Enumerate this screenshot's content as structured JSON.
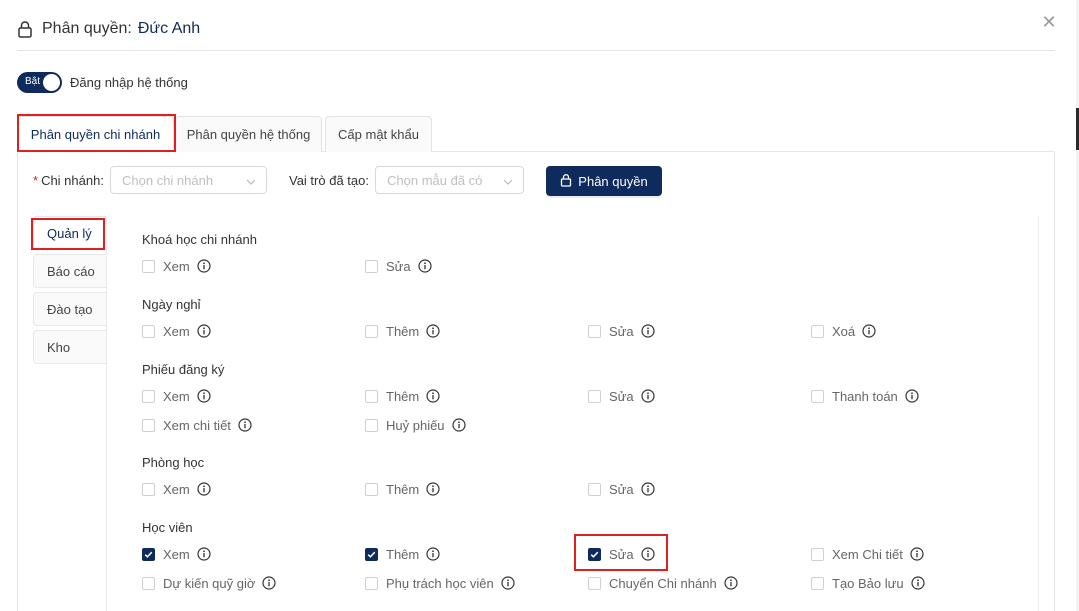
{
  "header": {
    "title_prefix": "Phân quyền:",
    "title_name": "Đức Anh"
  },
  "toggle": {
    "state_label": "Bật",
    "label": "Đăng nhập hệ thống"
  },
  "tabs": [
    {
      "label": "Phân quyền chi nhánh",
      "active": true
    },
    {
      "label": "Phân quyền hệ thống",
      "active": false
    },
    {
      "label": "Cấp mật khẩu",
      "active": false
    }
  ],
  "filters": {
    "branch_label": "Chi nhánh:",
    "branch_placeholder": "Chọn chi nhánh",
    "role_label": "Vai trò đã tạo:",
    "role_placeholder": "Chọn mẫu đã có",
    "submit_label": "Phân quyền"
  },
  "side_tabs": [
    {
      "label": "Quản lý",
      "active": true
    },
    {
      "label": "Báo cáo",
      "active": false
    },
    {
      "label": "Đào tạo",
      "active": false
    },
    {
      "label": "Kho",
      "active": false
    }
  ],
  "sections": [
    {
      "title": "Khoá học chi nhánh",
      "items": [
        {
          "label": "Xem",
          "checked": false
        },
        {
          "label": "Sửa",
          "checked": false
        }
      ]
    },
    {
      "title": "Ngày nghỉ",
      "items": [
        {
          "label": "Xem",
          "checked": false
        },
        {
          "label": "Thêm",
          "checked": false
        },
        {
          "label": "Sửa",
          "checked": false
        },
        {
          "label": "Xoá",
          "checked": false
        }
      ]
    },
    {
      "title": "Phiếu đăng ký",
      "items": [
        {
          "label": "Xem",
          "checked": false
        },
        {
          "label": "Thêm",
          "checked": false
        },
        {
          "label": "Sửa",
          "checked": false
        },
        {
          "label": "Thanh toán",
          "checked": false
        },
        {
          "label": "Xem chi tiết",
          "checked": false
        },
        {
          "label": "Huỷ phiếu",
          "checked": false
        }
      ]
    },
    {
      "title": "Phòng học",
      "items": [
        {
          "label": "Xem",
          "checked": false
        },
        {
          "label": "Thêm",
          "checked": false
        },
        {
          "label": "Sửa",
          "checked": false
        }
      ]
    },
    {
      "title": "Học viên",
      "items": [
        {
          "label": "Xem",
          "checked": true
        },
        {
          "label": "Thêm",
          "checked": true
        },
        {
          "label": "Sửa",
          "checked": true
        },
        {
          "label": "Xem Chi tiết",
          "checked": false
        },
        {
          "label": "Dự kiến quỹ giờ",
          "checked": false
        },
        {
          "label": "Phụ trách học viên",
          "checked": false
        },
        {
          "label": "Chuyển Chi nhánh",
          "checked": false
        },
        {
          "label": "Tạo Bảo lưu",
          "checked": false
        }
      ]
    }
  ],
  "colors": {
    "primary": "#0f2a5c",
    "highlight": "#e02020"
  }
}
